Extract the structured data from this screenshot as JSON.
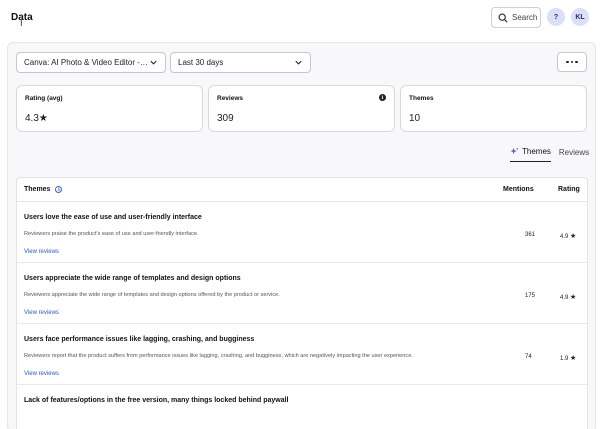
{
  "header": {
    "title": "Data",
    "search_label": "Search",
    "help_label": "?",
    "avatar_initials": "KL"
  },
  "filters": {
    "app": "Canva: AI Photo & Video Editor - A...",
    "date_range": "Last 30 days"
  },
  "stats": {
    "rating": {
      "label": "Rating (avg)",
      "value": "4.3★"
    },
    "reviews": {
      "label": "Reviews",
      "value": "309"
    },
    "themes": {
      "label": "Themes",
      "value": "10"
    }
  },
  "tabs": [
    {
      "label": "Themes",
      "active": true
    },
    {
      "label": "Reviews",
      "active": false
    }
  ],
  "table": {
    "columns": {
      "themes": "Themes",
      "mentions": "Mentions",
      "rating": "Rating"
    },
    "rows": [
      {
        "title": "Users love the ease of use and user-friendly interface",
        "description": "Reviewers praise the product's ease of use and user-friendly interface.",
        "link": "View reviews",
        "mentions": "361",
        "rating": "4.9"
      },
      {
        "title": "Users appreciate the wide range of templates and design options",
        "description": "Reviewers appreciate the wide range of templates and design options offered by the product or service.",
        "link": "View reviews",
        "mentions": "175",
        "rating": "4.9"
      },
      {
        "title": "Users face performance issues like lagging, crashing, and bugginess",
        "description": "Reviewers report that the product suffers from performance issues like lagging, crashing, and bugginess, which are negatively impacting the user experience.",
        "link": "View reviews",
        "mentions": "74",
        "rating": "1.9"
      },
      {
        "title": "Lack of features/options in the free version, many things locked behind paywall",
        "description": "",
        "link": "",
        "mentions": "",
        "rating": ""
      }
    ]
  },
  "colors": {
    "accent": "#2d57c4",
    "avatar_bg": "#dcdff8",
    "sparkle": "#6b4fd8"
  }
}
